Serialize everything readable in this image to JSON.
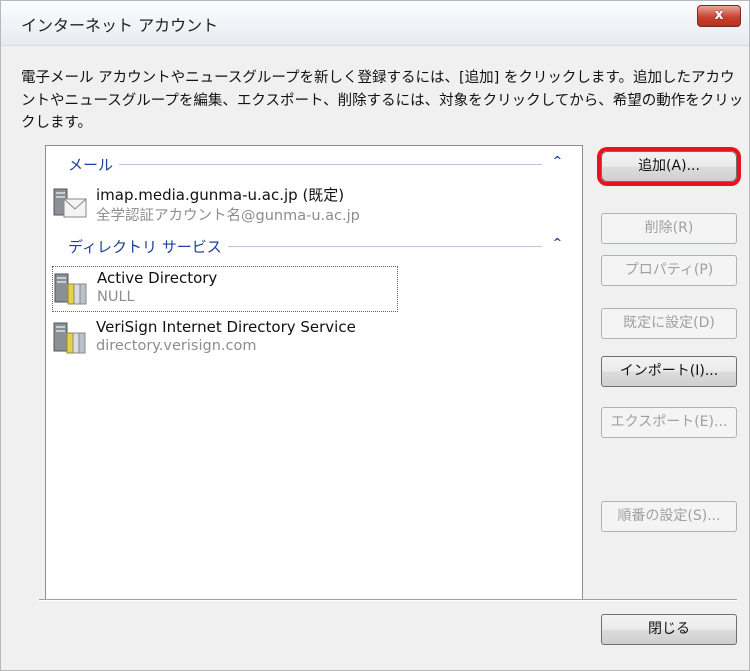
{
  "window": {
    "title": "インターネット アカウント",
    "close_label": "x"
  },
  "description": "電子メール アカウントやニュースグループを新しく登録するには、[追加] をクリックします。追加したアカウントやニュースグループを編集、エクスポート、削除するには、対象をクリックしてから、希望の動作をクリックします。",
  "groups": [
    {
      "label": "メール",
      "chevron": "^",
      "items": [
        {
          "name": "imap.media.gunma-u.ac.jp (既定)",
          "sub": "全学認証アカウント名@gunma-u.ac.jp",
          "icon": "mail-account-icon"
        }
      ]
    },
    {
      "label": "ディレクトリ サービス",
      "chevron": "^",
      "items": [
        {
          "name": "Active Directory",
          "sub": "NULL",
          "icon": "directory-service-icon"
        },
        {
          "name": "VeriSign Internet Directory Service",
          "sub": "directory.verisign.com",
          "icon": "directory-service-icon"
        }
      ]
    }
  ],
  "buttons": {
    "add": "追加(A)...",
    "delete": "削除(R)",
    "properties": "プロパティ(P)",
    "set_default": "既定に設定(D)",
    "import": "インポート(I)...",
    "export": "エクスポート(E)...",
    "order": "順番の設定(S)...",
    "close": "閉じる"
  },
  "colors": {
    "group_label": "#1e3f9a",
    "highlight_ring": "#e8141d",
    "close_button": "#c8432e"
  }
}
